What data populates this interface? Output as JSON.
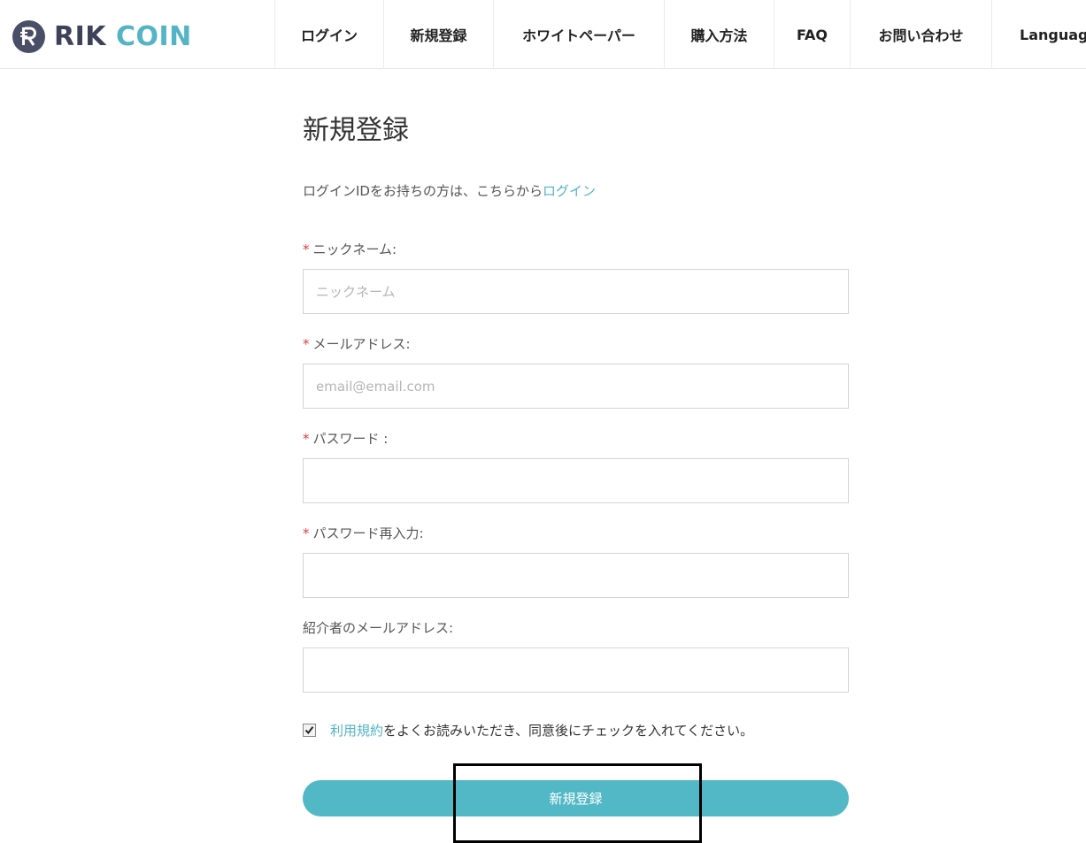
{
  "brand": {
    "name_part1": "RIK",
    "name_part2": "COIN",
    "mark_icon": "rik-logo-icon"
  },
  "nav": {
    "items": [
      {
        "label": "ログイン"
      },
      {
        "label": "新規登録"
      },
      {
        "label": "ホワイトペーパー"
      },
      {
        "label": "購入方法"
      },
      {
        "label": "FAQ"
      },
      {
        "label": "お問い合わせ"
      },
      {
        "label": "Language"
      }
    ]
  },
  "form": {
    "title": "新規登録",
    "login_note_prefix": "ログインIDをお持ちの方は、こちらから",
    "login_link": "ログイン",
    "required_mark": "*",
    "nickname": {
      "label": "ニックネーム:",
      "placeholder": "ニックネーム",
      "value": ""
    },
    "email": {
      "label": "メールアドレス:",
      "placeholder": "email@email.com",
      "value": ""
    },
    "password": {
      "label": "パスワード :",
      "value": ""
    },
    "password_confirm": {
      "label": "パスワード再入力:",
      "value": ""
    },
    "referrer_email": {
      "label": "紹介者のメールアドレス:",
      "value": ""
    },
    "terms": {
      "checked": true,
      "link": "利用規約",
      "text": "をよくお読みいただき、同意後にチェックを入れてください。"
    },
    "submit_label": "新規登録"
  },
  "colors": {
    "accent": "#52b8c6",
    "brand_dark": "#3d4159",
    "required": "#e03b3b"
  }
}
